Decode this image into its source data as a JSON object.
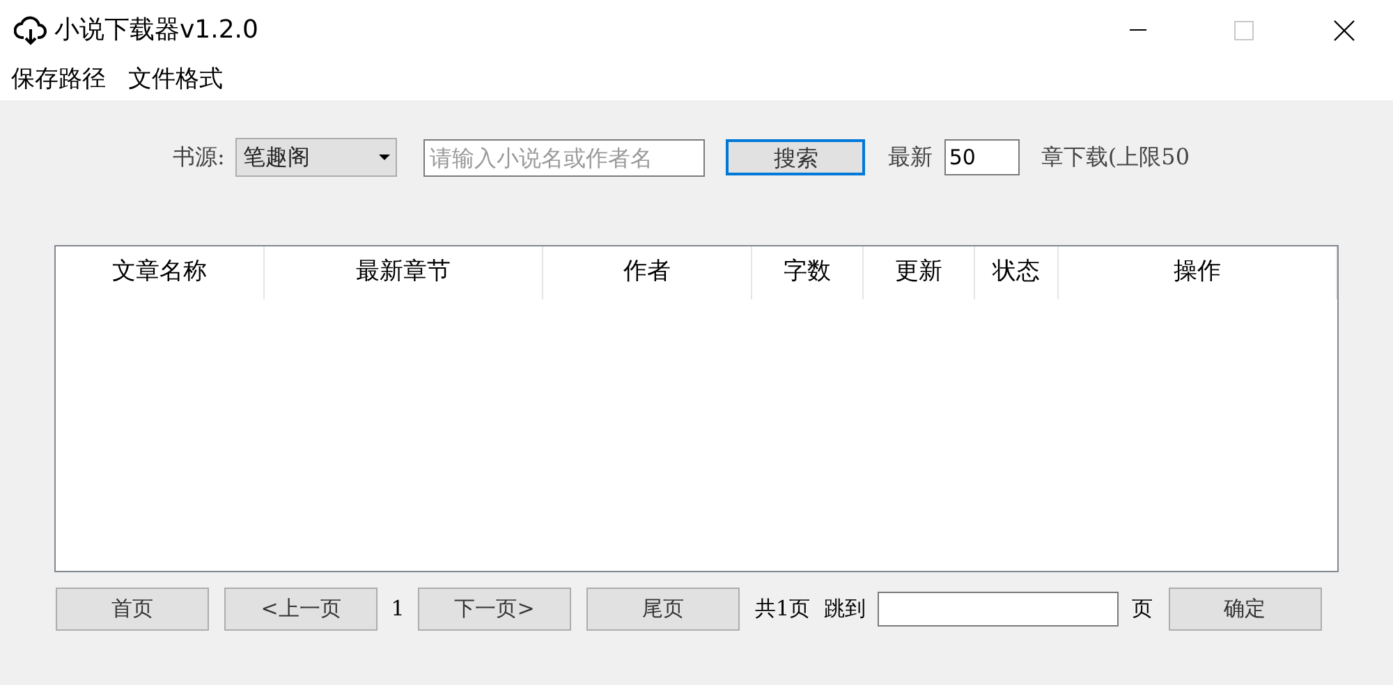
{
  "window": {
    "title": "小说下载器v1.2.0"
  },
  "menu": [
    "保存路径",
    "文件格式"
  ],
  "toolbar": {
    "source_label": "书源:",
    "source_value": "笔趣阁",
    "search_placeholder": "请输入小说名或作者名",
    "search_button": "搜索",
    "latest_label": "最新",
    "latest_value": "50",
    "suffix": "章下载(上限50"
  },
  "table": {
    "columns": [
      {
        "label": "文章名称"
      },
      {
        "label": "最新章节"
      },
      {
        "label": "作者"
      },
      {
        "label": "字数"
      },
      {
        "label": "更新"
      },
      {
        "label": "状态"
      },
      {
        "label": "操作"
      }
    ]
  },
  "pagination": {
    "first": "首页",
    "prev": "<上一页",
    "current": "1",
    "next": "下一页>",
    "last": "尾页",
    "total": "共1页",
    "jump_label": "跳到",
    "page_unit": "页",
    "confirm": "确定"
  }
}
